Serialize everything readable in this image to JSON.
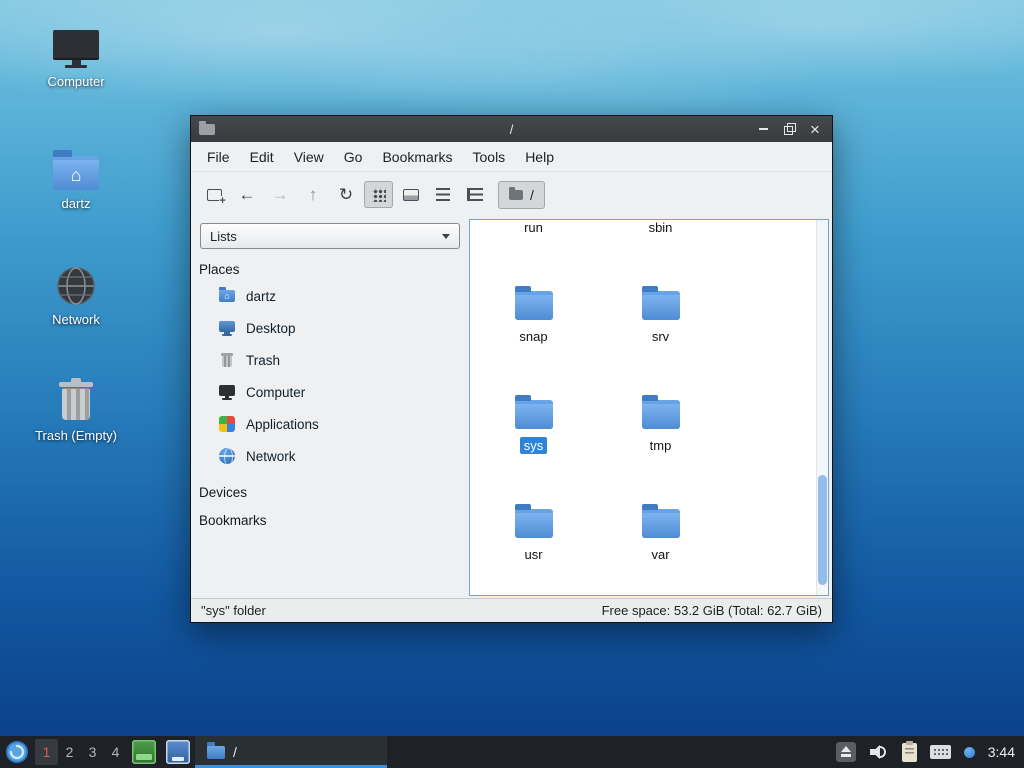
{
  "colors": {
    "selection": "#2f84d8",
    "folder": "#4f8cd4",
    "accent": "#3e8ed8",
    "taskbar_bg": "#1e2226",
    "titlebar_bg": "#3c3f42"
  },
  "desktop": {
    "icons": [
      {
        "label": "Computer",
        "icon": "computer-icon"
      },
      {
        "label": "dartz",
        "icon": "home-folder-icon"
      },
      {
        "label": "Network",
        "icon": "network-globe-icon"
      },
      {
        "label": "Trash (Empty)",
        "icon": "trash-icon"
      }
    ]
  },
  "window": {
    "title": "/",
    "controls": {
      "minimize": "minimize",
      "maximize": "maximize",
      "close": "close"
    },
    "menubar": [
      {
        "label": "File"
      },
      {
        "label": "Edit"
      },
      {
        "label": "View"
      },
      {
        "label": "Go"
      },
      {
        "label": "Bookmarks"
      },
      {
        "label": "Tools"
      },
      {
        "label": "Help"
      }
    ],
    "toolbar": {
      "buttons": [
        "new-tab",
        "back",
        "forward",
        "up",
        "refresh",
        "icon-view",
        "thumbnail-view",
        "compact-view",
        "detailed-list-view"
      ],
      "path_button": "/"
    },
    "sidebar": {
      "mode_selector": "Lists",
      "places_header": "Places",
      "places": [
        {
          "label": "dartz",
          "icon": "home-folder-icon"
        },
        {
          "label": "Desktop",
          "icon": "desktop-icon"
        },
        {
          "label": "Trash",
          "icon": "trash-icon"
        },
        {
          "label": "Computer",
          "icon": "computer-icon"
        },
        {
          "label": "Applications",
          "icon": "applications-icon"
        },
        {
          "label": "Network",
          "icon": "network-icon"
        }
      ],
      "devices_header": "Devices",
      "bookmarks_header": "Bookmarks"
    },
    "files": [
      {
        "name": "run"
      },
      {
        "name": "sbin"
      },
      {
        "name": "snap"
      },
      {
        "name": "srv"
      },
      {
        "name": "sys",
        "selected": true
      },
      {
        "name": "tmp"
      },
      {
        "name": "usr"
      },
      {
        "name": "var"
      }
    ],
    "statusbar": {
      "left": "\"sys\" folder",
      "right": "Free space: 53.2 GiB (Total: 62.7 GiB)"
    }
  },
  "taskbar": {
    "workspaces": [
      "1",
      "2",
      "3",
      "4"
    ],
    "active_workspace": "1",
    "task": {
      "label": "/",
      "icon": "folder-icon"
    },
    "clock": "3:44"
  }
}
